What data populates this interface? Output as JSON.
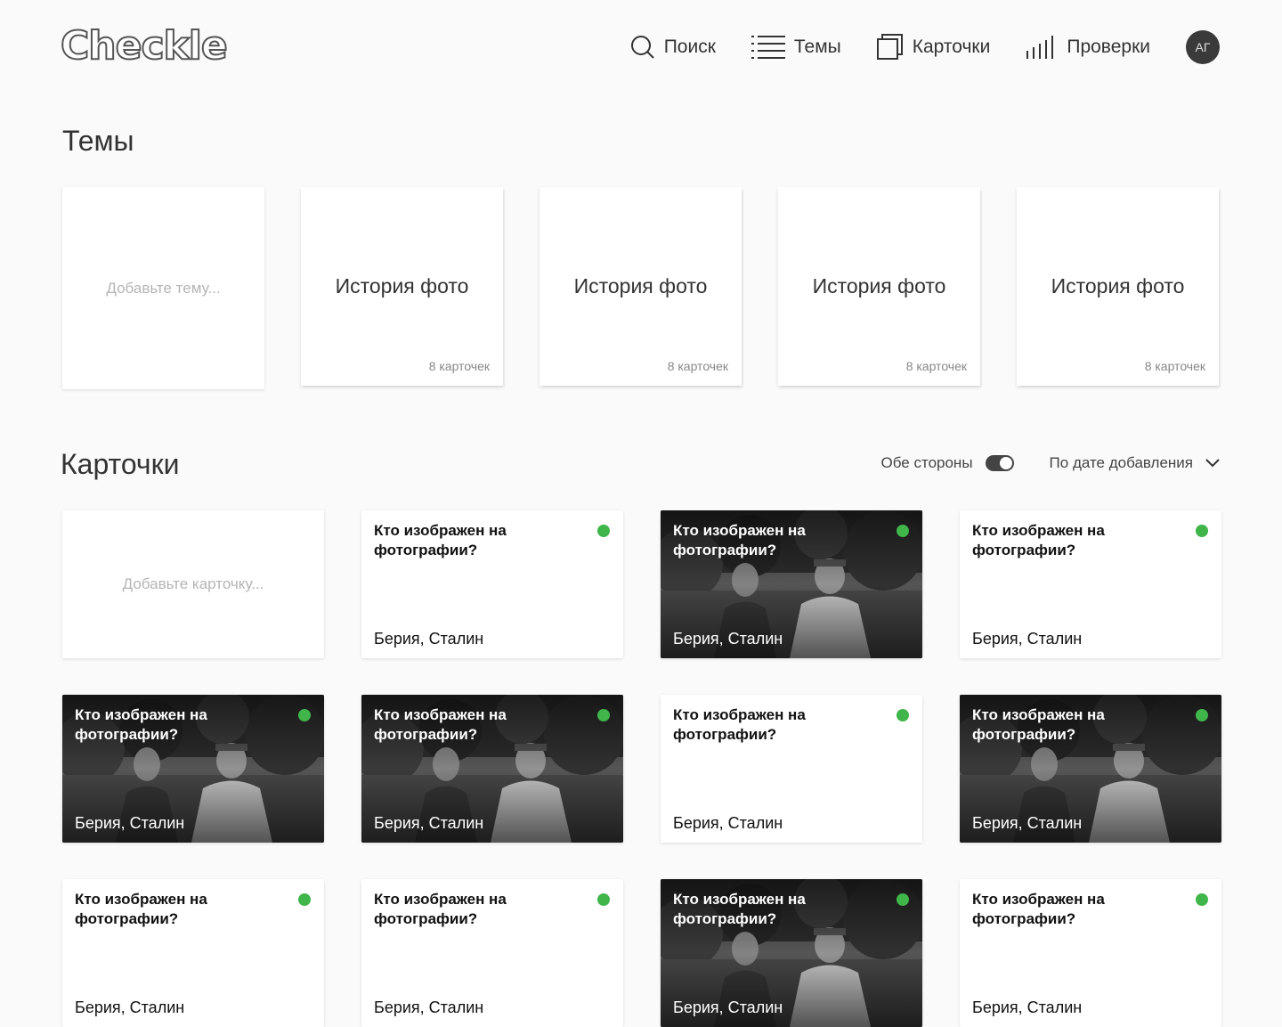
{
  "app": {
    "logo": "Checkle"
  },
  "nav": {
    "items": [
      {
        "label": "Поиск",
        "icon": "search-icon"
      },
      {
        "label": "Темы",
        "icon": "list-icon"
      },
      {
        "label": "Карточки",
        "icon": "cards-icon"
      },
      {
        "label": "Проверки",
        "icon": "bars-icon"
      }
    ],
    "avatar": "АГ"
  },
  "topics": {
    "title": "Темы",
    "add_placeholder": "Добавьте тему...",
    "items": [
      {
        "title": "История фото",
        "count": "8 карточек"
      },
      {
        "title": "История фото",
        "count": "8 карточек"
      },
      {
        "title": "История фото",
        "count": "8 карточек"
      },
      {
        "title": "История фото",
        "count": "8 карточек"
      }
    ]
  },
  "cards": {
    "title": "Карточки",
    "toggle_label": "Обе стороны",
    "toggle_on": true,
    "sort_label": "По дате добавления",
    "add_placeholder": "Добавьте карточку...",
    "status_color": "#3fb54a",
    "items": [
      {
        "question": "Кто изображен на фотографии?",
        "answer": "Берия, Сталин",
        "photo": false
      },
      {
        "question": "Кто изображен на фотографии?",
        "answer": "Берия, Сталин",
        "photo": true
      },
      {
        "question": "Кто изображен на фотографии?",
        "answer": "Берия, Сталин",
        "photo": false
      },
      {
        "question": "Кто изображен на фотографии?",
        "answer": "Берия, Сталин",
        "photo": true
      },
      {
        "question": "Кто изображен на фотографии?",
        "answer": "Берия, Сталин",
        "photo": true
      },
      {
        "question": "Кто изображен на фотографии?",
        "answer": "Берия, Сталин",
        "photo": false
      },
      {
        "question": "Кто изображен на фотографии?",
        "answer": "Берия, Сталин",
        "photo": true
      },
      {
        "question": "Кто изображен на фотографии?",
        "answer": "Берия, Сталин",
        "photo": false
      },
      {
        "question": "Кто изображен на фотографии?",
        "answer": "Берия, Сталин",
        "photo": false
      },
      {
        "question": "Кто изображен на фотографии?",
        "answer": "Берия, Сталин",
        "photo": true
      },
      {
        "question": "Кто изображен на фотографии?",
        "answer": "Берия, Сталин",
        "photo": false
      }
    ]
  }
}
